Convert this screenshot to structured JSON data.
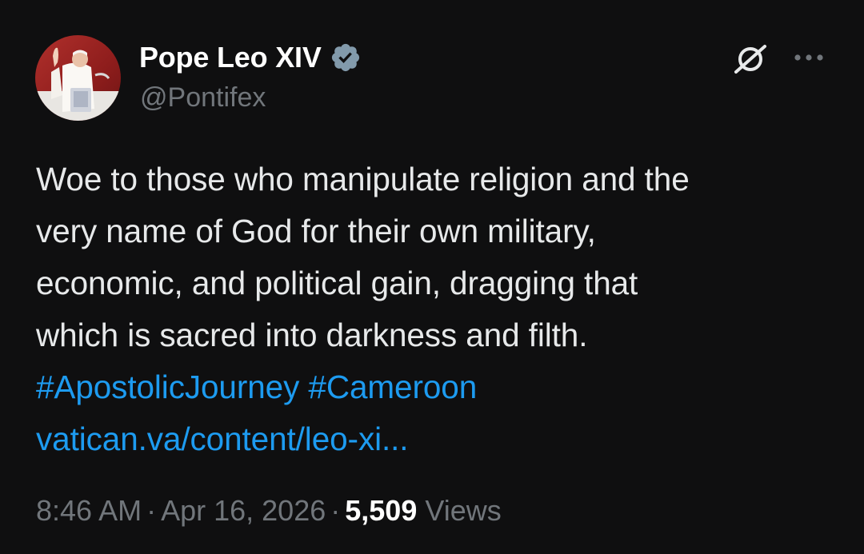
{
  "author": {
    "display_name": "Pope Leo XIV",
    "handle": "@Pontifex",
    "verified": true,
    "verified_color": "#829aab"
  },
  "tweet": {
    "lines": [
      "Woe to those who manipulate religion and the",
      "very name of God for their own military,",
      "economic, and political gain, dragging that",
      "which is sacred into darkness and filth."
    ],
    "hashtags": [
      "#ApostolicJourney",
      "#Cameroon"
    ],
    "link_text": "vatican.va/content/leo-xi...",
    "link_color": "#1d9bf0"
  },
  "meta": {
    "time": "8:46 AM",
    "separator": "·",
    "date": "Apr 16, 2026",
    "views_count": "5,509",
    "views_label": "Views"
  },
  "icons": {
    "grok": "grok-icon",
    "more": "more-icon",
    "verified": "verified-badge-icon"
  }
}
